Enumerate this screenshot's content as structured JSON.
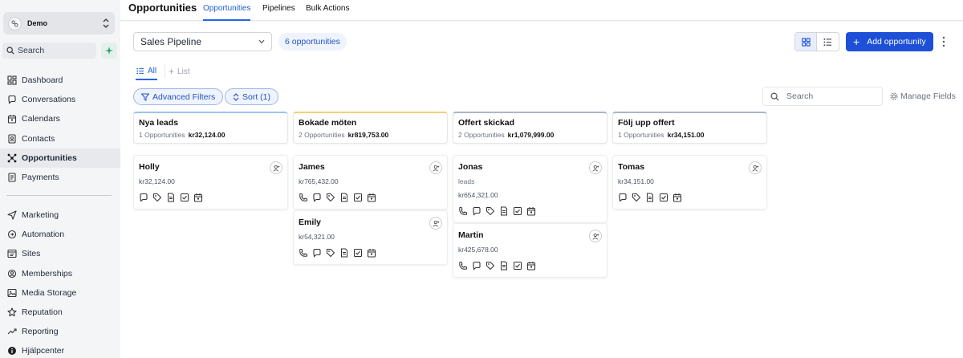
{
  "sidebar": {
    "account_name": "Demo",
    "search_label": "Search",
    "nav_primary": [
      {
        "label": "Dashboard",
        "icon": "dashboard-icon"
      },
      {
        "label": "Conversations",
        "icon": "chat-icon"
      },
      {
        "label": "Calendars",
        "icon": "calendar-icon"
      },
      {
        "label": "Contacts",
        "icon": "contacts-icon"
      },
      {
        "label": "Opportunities",
        "icon": "opportunities-icon",
        "active": true
      },
      {
        "label": "Payments",
        "icon": "payments-icon"
      }
    ],
    "nav_secondary": [
      {
        "label": "Marketing",
        "icon": "send-icon"
      },
      {
        "label": "Automation",
        "icon": "automation-icon"
      },
      {
        "label": "Sites",
        "icon": "sites-icon"
      },
      {
        "label": "Memberships",
        "icon": "memberships-icon"
      },
      {
        "label": "Media Storage",
        "icon": "image-icon"
      },
      {
        "label": "Reputation",
        "icon": "star-icon"
      },
      {
        "label": "Reporting",
        "icon": "chart-line-icon"
      },
      {
        "label": "Hjälpcenter",
        "icon": "info-icon"
      }
    ]
  },
  "header": {
    "title": "Opportunities",
    "tabs": [
      "Opportunities",
      "Pipelines",
      "Bulk Actions"
    ]
  },
  "toolbar": {
    "pipeline": "Sales Pipeline",
    "count": "6 opportunities",
    "add_label": "Add opportunity"
  },
  "view_tabs": {
    "all": "All",
    "list": "List"
  },
  "filters": {
    "advanced": "Advanced Filters",
    "sort": "Sort (1)",
    "search_placeholder": "Search",
    "manage_fields": "Manage Fields"
  },
  "columns": [
    {
      "name": "Nya leads",
      "count": "1 Opportunities",
      "total": "kr32,124.00",
      "color": "#9ec3f0",
      "cards": [
        {
          "name": "Holly",
          "value": "kr32,124.00",
          "icons": [
            "chat-icon",
            "tag-icon",
            "note-icon",
            "task-icon",
            "calendar-icon"
          ]
        }
      ]
    },
    {
      "name": "Bokade möten",
      "count": "2 Opportunities",
      "total": "kr819,753.00",
      "color": "#f2cf7a",
      "cards": [
        {
          "name": "James",
          "value": "kr765,432.00",
          "icons": [
            "phone-icon",
            "chat-icon",
            "tag-icon",
            "note-icon",
            "task-icon",
            "calendar-icon"
          ]
        },
        {
          "name": "Emily",
          "value": "kr54,321.00",
          "icons": [
            "phone-icon",
            "chat-icon",
            "tag-icon",
            "note-icon",
            "task-icon",
            "calendar-icon"
          ]
        }
      ]
    },
    {
      "name": "Offert skickad",
      "count": "2 Opportunities",
      "total": "kr1,079,999.00",
      "color": "#aab6cc",
      "cards": [
        {
          "name": "Jonas",
          "sub": "leads",
          "value": "kr654,321.00",
          "icons": [
            "phone-icon",
            "chat-icon",
            "tag-icon",
            "note-icon",
            "task-icon",
            "calendar-icon"
          ]
        },
        {
          "name": "Martin",
          "value": "kr425,678.00",
          "icons": [
            "phone-icon",
            "chat-icon",
            "tag-icon",
            "note-icon",
            "task-icon",
            "calendar-icon"
          ]
        }
      ]
    },
    {
      "name": "Följ upp offert",
      "count": "1 Opportunities",
      "total": "kr34,151.00",
      "color": "#aab6cc",
      "cards": [
        {
          "name": "Tomas",
          "value": "kr34,151.00",
          "icons": [
            "chat-icon",
            "tag-icon",
            "note-icon",
            "task-icon",
            "calendar-icon"
          ]
        }
      ]
    }
  ],
  "colors": {
    "accent": "#1d4fd7",
    "tab_active": "#1d5fd0"
  }
}
